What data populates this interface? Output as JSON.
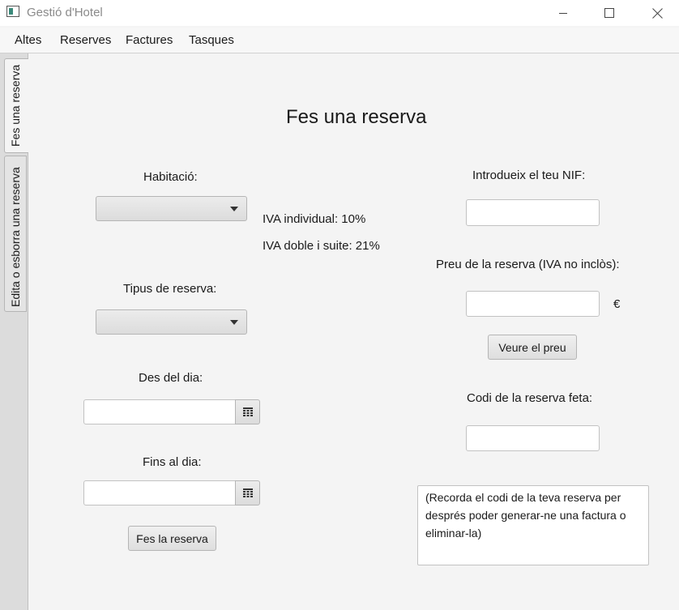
{
  "window": {
    "title": "Gestió d'Hotel",
    "minimize_glyph": "—",
    "maximize_glyph": "☐",
    "close_glyph": "✕"
  },
  "menu": [
    "Altes",
    "Reserves",
    "Factures",
    "Tasques"
  ],
  "tabs": [
    {
      "label": "Fes una reserva",
      "selected": true
    },
    {
      "label": "Edita o esborra una reserva",
      "selected": false
    }
  ],
  "form": {
    "heading": "Fes una reserva",
    "habitacio_label": "Habitació:",
    "habitacio_value": "",
    "iva_individual": "IVA individual: 10%",
    "iva_doble": "IVA  doble i suite: 21%",
    "tipus_label": "Tipus de reserva:",
    "tipus_value": "",
    "des_label": "Des del dia:",
    "des_value": "",
    "fins_label": "Fins al dia:",
    "fins_value": "",
    "submit_label": "Fes la reserva",
    "nif_label": "Introdueix el teu NIF:",
    "nif_value": "",
    "preu_label": "Preu de la reserva (IVA no inclòs):",
    "preu_value": "",
    "currency": "€",
    "veure_preu_label": "Veure el preu",
    "codi_label": "Codi de la reserva feta:",
    "codi_value": "",
    "note": "(Recorda el codi de la teva reserva per després poder generar-ne una factura o eliminar-la)"
  },
  "icons": {
    "calendar": "calendar-icon",
    "dropdown": "chevron-down-icon",
    "app": "app-icon"
  }
}
